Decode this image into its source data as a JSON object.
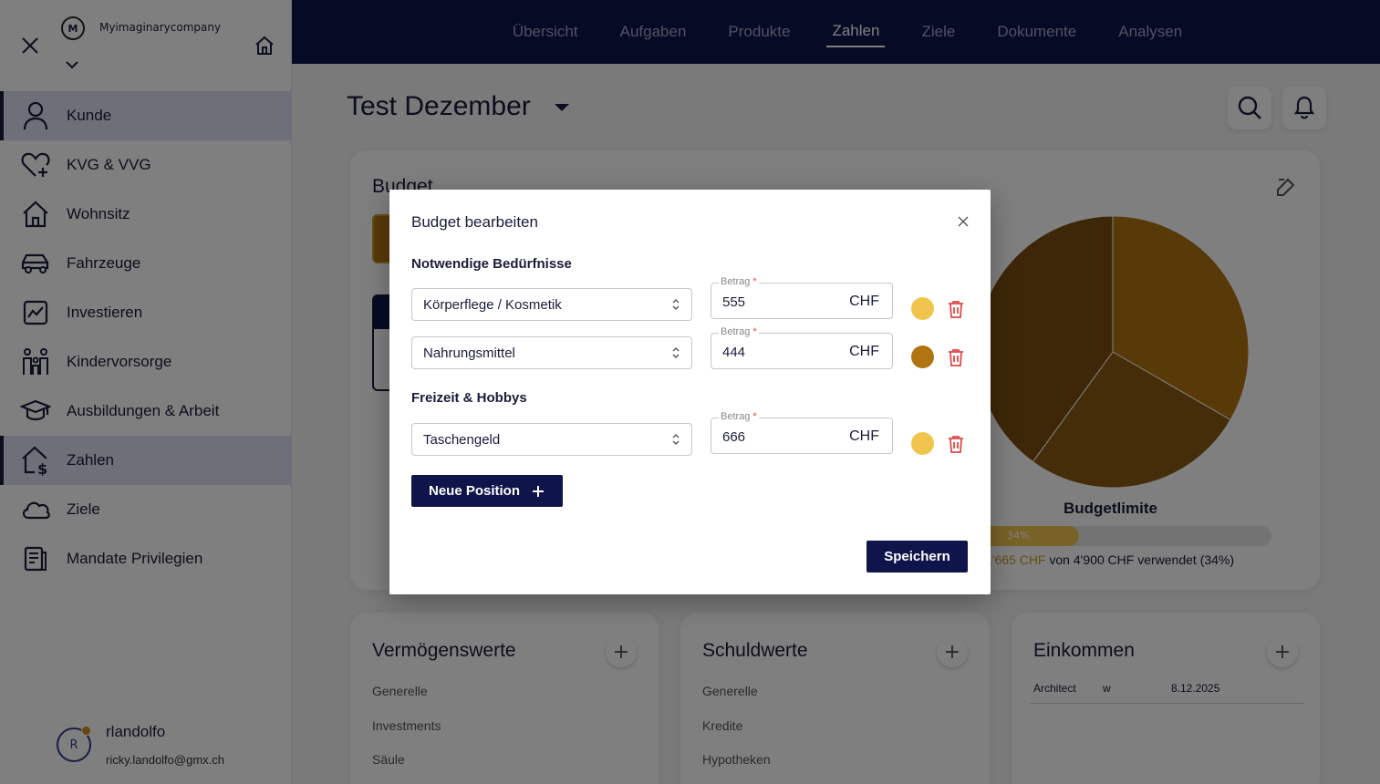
{
  "sidebar": {
    "org_initial": "M",
    "org_name": "Myimaginarycompany",
    "items": [
      {
        "label": "Kunde",
        "icon": "user-icon"
      },
      {
        "label": "KVG & VVG",
        "icon": "heart-plus-icon"
      },
      {
        "label": "Wohnsitz",
        "icon": "house-icon"
      },
      {
        "label": "Fahrzeuge",
        "icon": "car-icon"
      },
      {
        "label": "Investieren",
        "icon": "chart-line-icon"
      },
      {
        "label": "Kindervorsorge",
        "icon": "family-icon"
      },
      {
        "label": "Ausbildungen & Arbeit",
        "icon": "graduation-cap-icon"
      },
      {
        "label": "Zahlen",
        "icon": "house-dollar-icon"
      },
      {
        "label": "Ziele",
        "icon": "cloud-icon"
      },
      {
        "label": "Mandate Privilegien",
        "icon": "document-icon"
      }
    ],
    "active_items": [
      "Kunde",
      "Zahlen"
    ],
    "user": {
      "initial": "R",
      "name": "rlandolfo",
      "email": "ricky.landolfo@gmx.ch",
      "status_color": "#d08a18"
    }
  },
  "topnav": {
    "items": [
      "Übersicht",
      "Aufgaben",
      "Produkte",
      "Zahlen",
      "Ziele",
      "Dokumente",
      "Analysen"
    ],
    "active": "Zahlen"
  },
  "page": {
    "title": "Test Dezember"
  },
  "budget_card": {
    "title": "Budget",
    "chart_label": "Budgetlimite",
    "progress_label": "34%",
    "progress_fraction": 0.34,
    "used_text": "1'665 CHF",
    "used_suffix": "von 4'900 CHF verwendet (34%)"
  },
  "cards": {
    "assets": {
      "title": "Vermögenswerte",
      "rows": [
        "Generelle",
        "Investments",
        "Säule"
      ]
    },
    "debts": {
      "title": "Schuldwerte",
      "rows": [
        "Generelle",
        "Kredite",
        "Hypotheken"
      ]
    },
    "income": {
      "title": "Einkommen",
      "row": {
        "name": "Architect",
        "type": "w",
        "date": "8.12.2025"
      }
    }
  },
  "modal": {
    "title": "Budget bearbeiten",
    "amount_label": "Betrag",
    "required_mark": "*",
    "currency": "CHF",
    "sections": [
      {
        "title": "Notwendige Bedürfnisse",
        "rows": [
          {
            "category": "Körperflege / Kosmetik",
            "amount": "555",
            "color": "#f1c44e"
          },
          {
            "category": "Nahrungsmittel",
            "amount": "444",
            "color": "#b07410"
          }
        ]
      },
      {
        "title": "Freizeit & Hobbys",
        "rows": [
          {
            "category": "Taschengeld",
            "amount": "666",
            "color": "#f1c44e"
          }
        ]
      }
    ],
    "add_button": "Neue Position",
    "save_button": "Speichern"
  },
  "chart_data": {
    "type": "pie",
    "values": [
      555,
      444,
      666
    ],
    "colors": [
      "#b07410",
      "#8a5a12",
      "#7b4f10"
    ],
    "title": "Budgetlimite"
  }
}
